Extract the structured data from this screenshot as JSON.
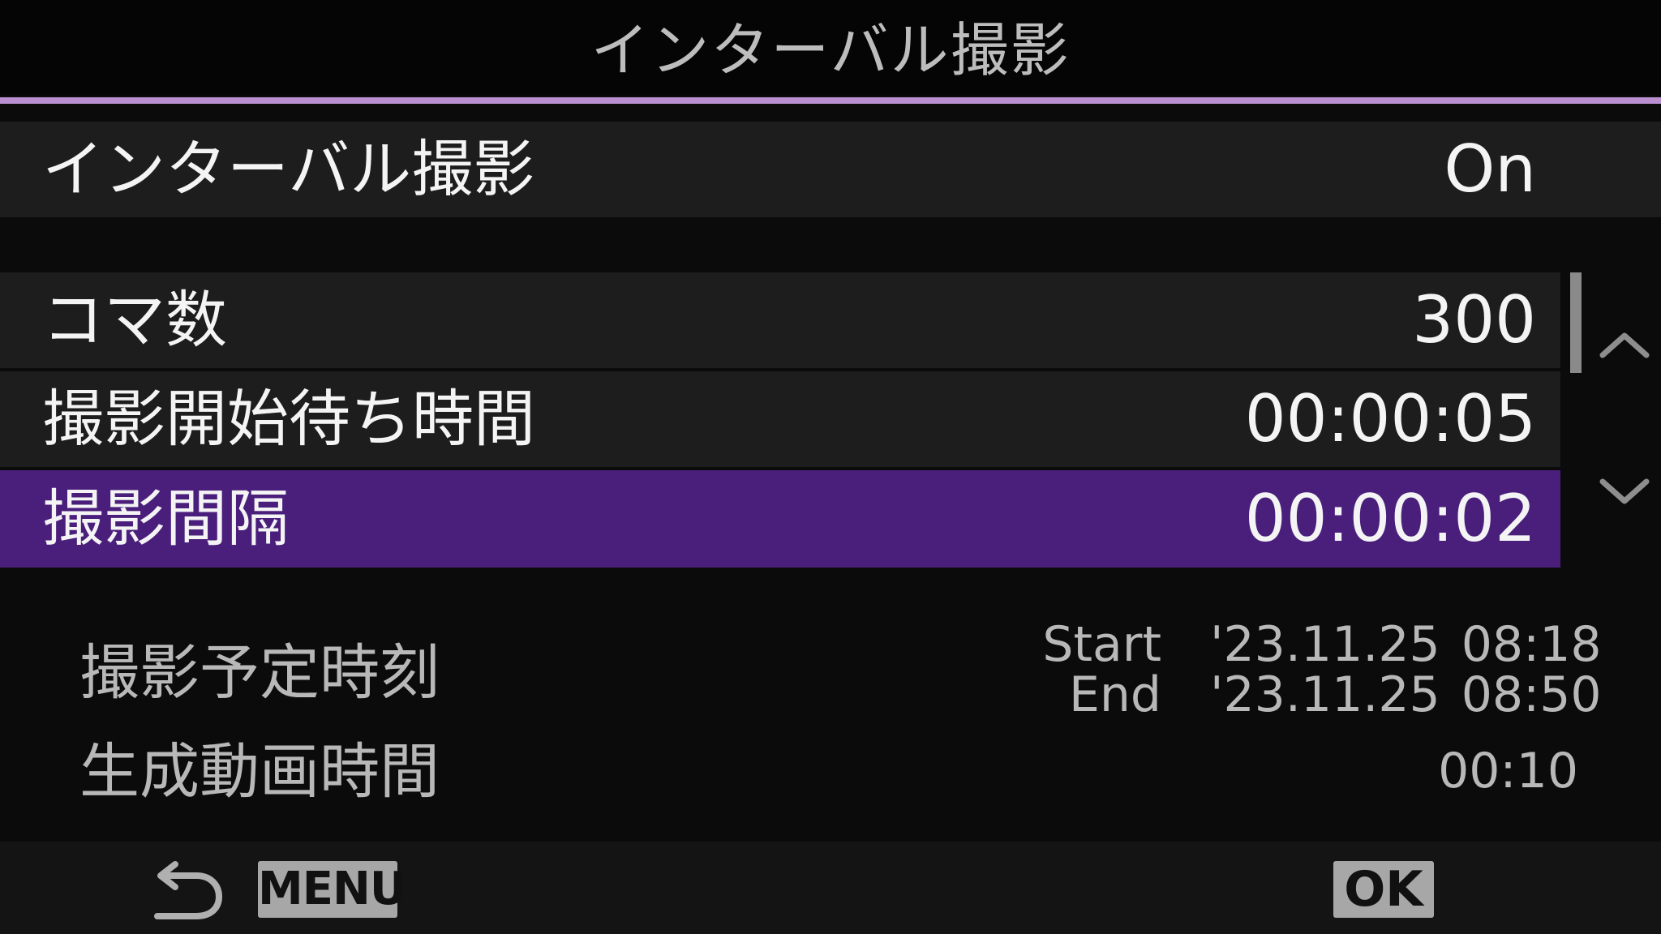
{
  "header": {
    "title": "インターバル撮影"
  },
  "settings": {
    "interval_shooting": {
      "label": "インターバル撮影",
      "value": "On"
    },
    "frames": {
      "label": "コマ数",
      "value": "300"
    },
    "start_wait": {
      "label": "撮影開始待ち時間",
      "value": "00:00:05"
    },
    "interval": {
      "label": "撮影間隔",
      "value": "00:00:02"
    }
  },
  "info": {
    "schedule_label": "撮影予定時刻",
    "start_key": "Start",
    "start_date": "'23.11.25",
    "start_time": "08:18",
    "end_key": "End",
    "end_date": "'23.11.25",
    "end_time": "08:50",
    "movie_length_label": "生成動画時間",
    "movie_length_value": "00:10"
  },
  "footer": {
    "back_key": "MENU",
    "confirm_key": "OK"
  },
  "colors": {
    "accent_rule": "#b98fd0",
    "selected_row": "#4a1f7c",
    "row_background": "#1d1d1d",
    "screen_background": "#0b0b0b"
  },
  "icons": {
    "back": "back-arrow-icon",
    "scroll_up": "chevron-up-icon",
    "scroll_down": "chevron-down-icon"
  },
  "scroll": {
    "position_fraction": 0.0
  }
}
